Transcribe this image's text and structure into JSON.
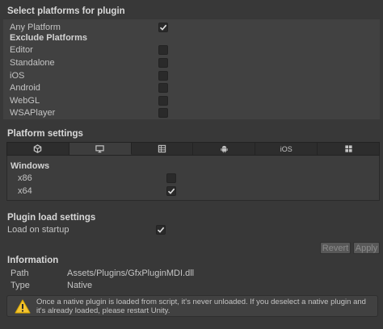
{
  "select_platforms": {
    "header": "Select platforms for plugin",
    "any_platform": {
      "label": "Any Platform",
      "checked": true
    },
    "exclude_header": "Exclude Platforms",
    "platforms": [
      {
        "label": "Editor",
        "checked": false
      },
      {
        "label": "Standalone",
        "checked": false
      },
      {
        "label": "iOS",
        "checked": false
      },
      {
        "label": "Android",
        "checked": false
      },
      {
        "label": "WebGL",
        "checked": false
      },
      {
        "label": "WSAPlayer",
        "checked": false
      }
    ]
  },
  "platform_settings": {
    "header": "Platform settings",
    "tabs": [
      {
        "icon": "unity-icon",
        "label": ""
      },
      {
        "icon": "monitor-icon",
        "label": "",
        "active": true
      },
      {
        "icon": "grid-icon",
        "label": ""
      },
      {
        "icon": "android-icon",
        "label": ""
      },
      {
        "icon": "",
        "label": "iOS"
      },
      {
        "icon": "windows-icon",
        "label": ""
      }
    ],
    "windows_header": "Windows",
    "arch": [
      {
        "label": "x86",
        "checked": false
      },
      {
        "label": "x64",
        "checked": true
      }
    ]
  },
  "plugin_load": {
    "header": "Plugin load settings",
    "load_on_startup": {
      "label": "Load on startup",
      "checked": true
    }
  },
  "buttons": {
    "revert": "Revert",
    "apply": "Apply"
  },
  "information": {
    "header": "Information",
    "path_label": "Path",
    "path_value": "Assets/Plugins/GfxPluginMDI.dll",
    "type_label": "Type",
    "type_value": "Native"
  },
  "warning": {
    "message": "Once a native plugin is loaded from script, it's never unloaded. If you deselect a native plugin and it's already loaded, please restart Unity."
  },
  "colors": {
    "background": "#383838",
    "panel": "#414141",
    "warning": "#f4c430"
  }
}
